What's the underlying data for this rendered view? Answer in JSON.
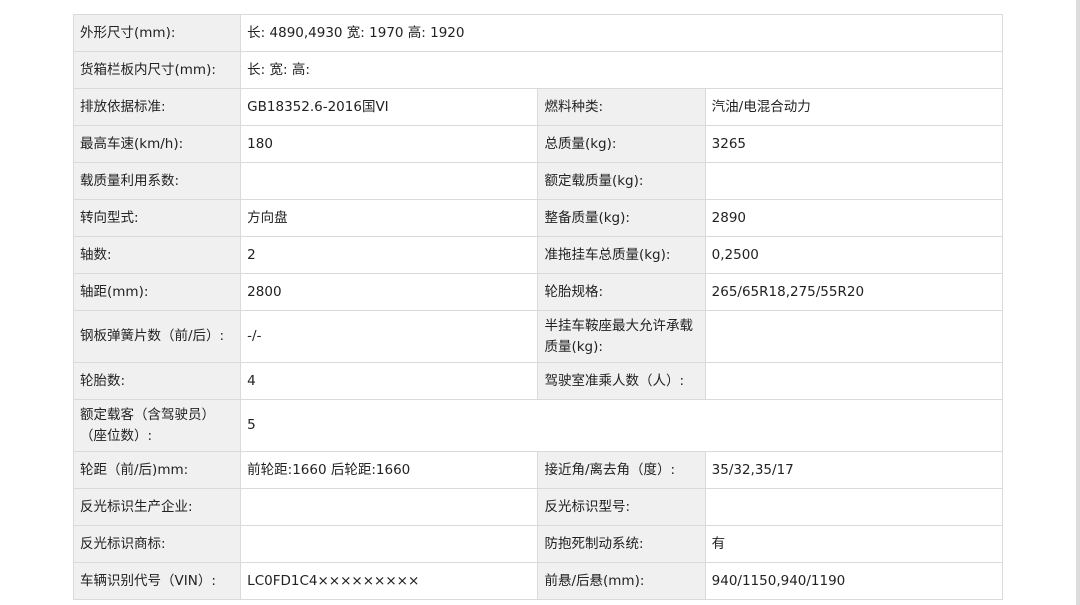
{
  "rows": [
    {
      "k1": "外形尺寸(mm):",
      "v1": "长: 4890,4930 宽: 1970 高: 1920"
    },
    {
      "k1": "货箱栏板内尺寸(mm):",
      "v1": "长:  宽:  高:"
    },
    {
      "k1": "排放依据标准:",
      "v1": "GB18352.6-2016国VI",
      "k2": "燃料种类:",
      "v2": "汽油/电混合动力"
    },
    {
      "k1": "最高车速(km/h):",
      "v1": "180",
      "k2": "总质量(kg):",
      "v2": "3265"
    },
    {
      "k1": "载质量利用系数:",
      "v1": "",
      "k2": "额定载质量(kg):",
      "v2": ""
    },
    {
      "k1": "转向型式:",
      "v1": "方向盘",
      "k2": "整备质量(kg):",
      "v2": "2890"
    },
    {
      "k1": "轴数:",
      "v1": "2",
      "k2": "准拖挂车总质量(kg):",
      "v2": "0,2500"
    },
    {
      "k1": "轴距(mm):",
      "v1": "2800",
      "k2": "轮胎规格:",
      "v2": "265/65R18,275/55R20"
    },
    {
      "k1": "钢板弹簧片数（前/后）:",
      "v1": "-/-",
      "k2": "半挂车鞍座最大允许承载质量(kg):",
      "v2": ""
    },
    {
      "k1": "轮胎数:",
      "v1": "4",
      "k2": "驾驶室准乘人数（人）:",
      "v2": ""
    },
    {
      "k1": "额定载客（含驾驶员）（座位数）:",
      "v1": "5"
    },
    {
      "k1": "轮距（前/后)mm:",
      "v1": "前轮距:1660 后轮距:1660",
      "k2": "接近角/离去角（度）:",
      "v2": "35/32,35/17"
    },
    {
      "k1": "反光标识生产企业:",
      "v1": "",
      "k2": "反光标识型号:",
      "v2": ""
    },
    {
      "k1": "反光标识商标:",
      "v1": "",
      "k2": "防抱死制动系统:",
      "v2": "有"
    },
    {
      "k1": "车辆识别代号（VIN）:",
      "v1": "LC0FD1C4×××××××××",
      "k2": "前悬/后悬(mm):",
      "v2": "940/1150,940/1190"
    }
  ]
}
